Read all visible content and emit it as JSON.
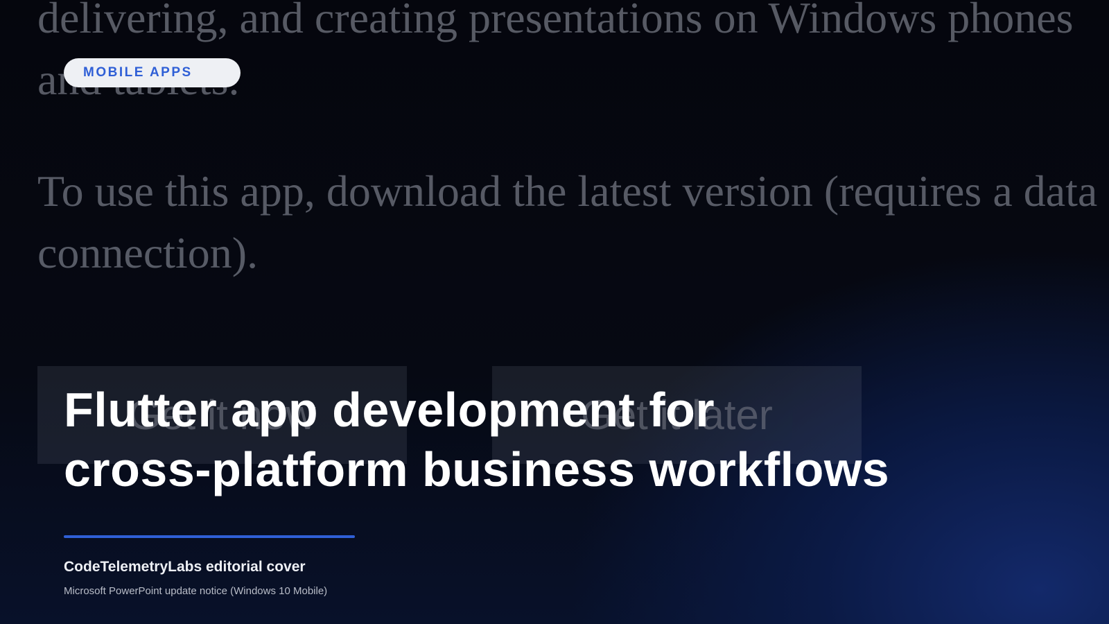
{
  "background_text": {
    "paragraph1": "delivering, and creating presentations on Windows phones and tablets.",
    "paragraph2": "To use this app, download the latest version (requires a data connection).",
    "button_now": "Get it now",
    "button_later": "Get it later"
  },
  "category_pill": "MOBILE APPS",
  "headline": {
    "line1": "Flutter app development for",
    "line2": "cross-platform business workflows"
  },
  "brand": "CodeTelemetryLabs editorial cover",
  "caption": "Microsoft PowerPoint update notice (Windows 10 Mobile)",
  "colors": {
    "accent": "#2f5fd6",
    "pill_background": "#eef0f4",
    "headline": "#ffffff"
  }
}
